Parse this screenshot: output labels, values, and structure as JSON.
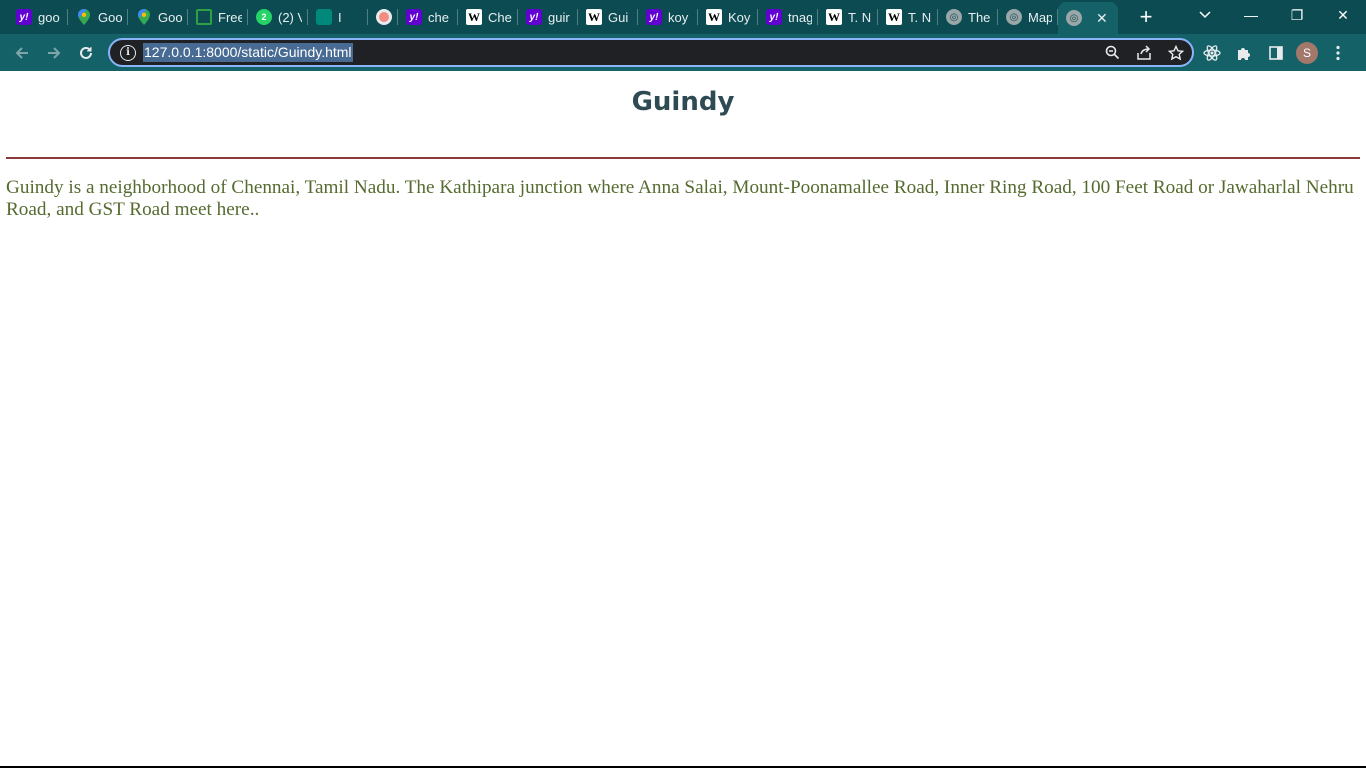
{
  "browser": {
    "tabs": [
      {
        "favicon": "yahoo-icon",
        "title": "goo"
      },
      {
        "favicon": "maps-icon",
        "title": "Goo"
      },
      {
        "favicon": "maps-icon",
        "title": "Goo"
      },
      {
        "favicon": "image-icon",
        "title": "Free"
      },
      {
        "favicon": "whatsapp-icon",
        "title": "(2) V"
      },
      {
        "favicon": "meet-icon",
        "title": "I"
      },
      {
        "favicon": "record-icon",
        "title": ""
      },
      {
        "favicon": "yahoo-icon",
        "title": "che"
      },
      {
        "favicon": "wikipedia-icon",
        "title": "Che"
      },
      {
        "favicon": "yahoo-icon",
        "title": "guir"
      },
      {
        "favicon": "wikipedia-icon",
        "title": "Gui"
      },
      {
        "favicon": "yahoo-icon",
        "title": "koy"
      },
      {
        "favicon": "wikipedia-icon",
        "title": "Koy"
      },
      {
        "favicon": "yahoo-icon",
        "title": "tnag"
      },
      {
        "favicon": "wikipedia-icon",
        "title": "T. N"
      },
      {
        "favicon": "wikipedia-icon",
        "title": "T. N"
      },
      {
        "favicon": "globe-icon",
        "title": "The"
      },
      {
        "favicon": "globe-icon",
        "title": "Map"
      }
    ],
    "active_tab": {
      "favicon": "globe-icon",
      "close": "✕"
    },
    "new_tab": "+",
    "address": {
      "url": "127.0.0.1:8000/static/Guindy.html"
    },
    "profile_initial": "S",
    "window_controls": {
      "minimize": "—",
      "restore": "❐",
      "close": "✕"
    }
  },
  "page": {
    "title": "Guindy",
    "paragraph": "Guindy is a neighborhood of Chennai, Tamil Nadu. The Kathipara junction where Anna Salai, Mount-Poonamallee Road, Inner Ring Road, 100 Feet Road or Jawaharlal Nehru Road, and GST Road meet here.."
  },
  "colors": {
    "tabstrip": "#0d4b53",
    "toolbar": "#146168",
    "title": "#2e4a52",
    "rule": "#8b3a3a",
    "paragraph": "#556b2f"
  }
}
